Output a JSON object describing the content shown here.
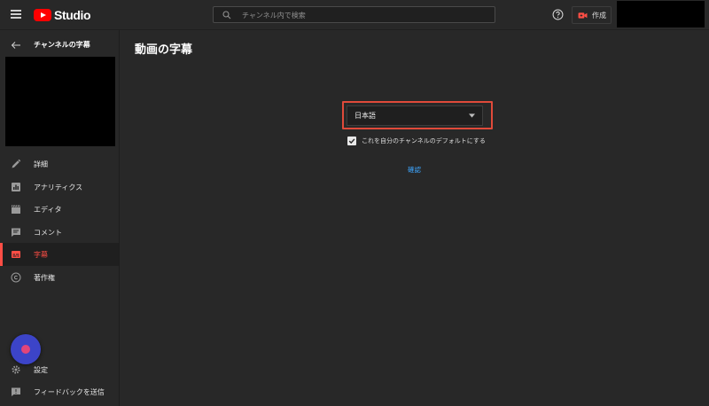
{
  "header": {
    "app_name": "Studio",
    "search_placeholder": "チャンネル内で検索",
    "create_label": "作成"
  },
  "sidebar": {
    "title": "チャンネルの字幕",
    "items": [
      {
        "label": "詳細",
        "icon": "pencil-icon"
      },
      {
        "label": "アナリティクス",
        "icon": "analytics-icon"
      },
      {
        "label": "エディタ",
        "icon": "clapperboard-icon"
      },
      {
        "label": "コメント",
        "icon": "comment-icon"
      },
      {
        "label": "字幕",
        "icon": "subtitles-icon",
        "active": true
      },
      {
        "label": "著作権",
        "icon": "copyright-icon"
      }
    ],
    "bottom_items": [
      {
        "label": "設定",
        "icon": "gear-icon"
      },
      {
        "label": "フィードバックを送信",
        "icon": "feedback-icon"
      }
    ]
  },
  "main": {
    "title": "動画の字幕",
    "language_select": {
      "value": "日本語"
    },
    "default_checkbox": {
      "label": "これを自分のチャンネルのデフォルトにする",
      "checked": true
    },
    "confirm_label": "確認"
  },
  "colors": {
    "accent_red": "#ff4e45",
    "link_blue": "#3ea6ff",
    "highlight": "#e04a3a",
    "background": "#282828"
  }
}
